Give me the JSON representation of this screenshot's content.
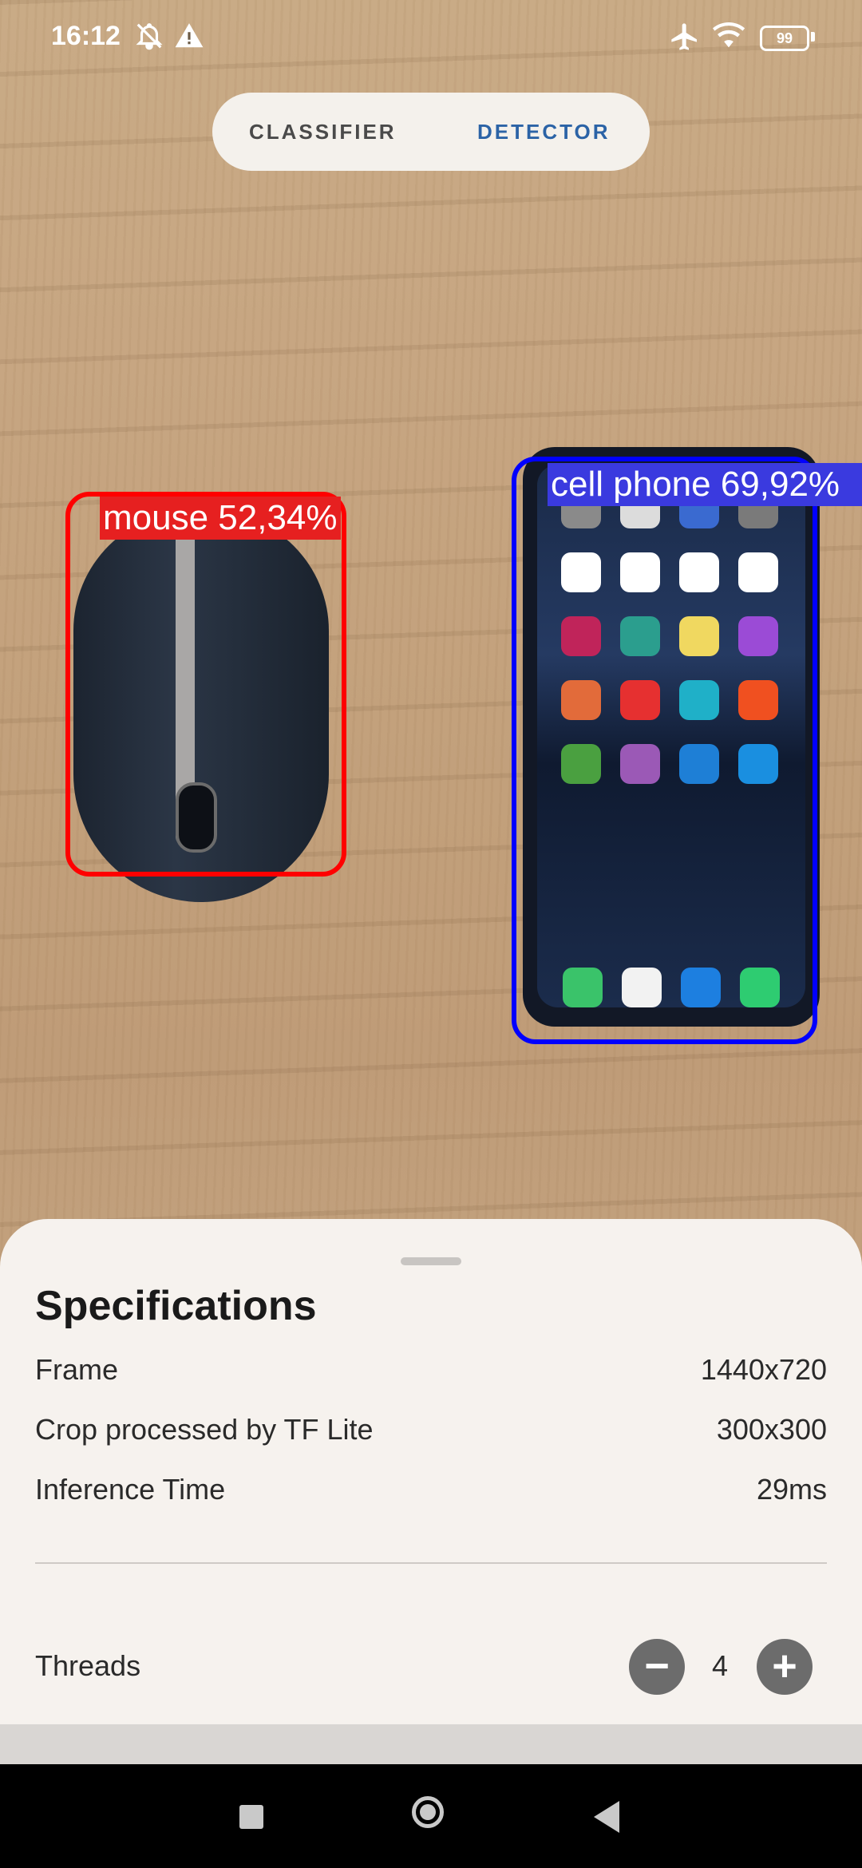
{
  "status_bar": {
    "time": "16:12",
    "battery": "99",
    "icons": [
      "mute-notifications-icon",
      "warning-icon",
      "airplane-icon",
      "wifi-icon",
      "battery-icon"
    ]
  },
  "tabs": [
    {
      "label": "CLASSIFIER",
      "active": false
    },
    {
      "label": "DETECTOR",
      "active": true
    }
  ],
  "detections": [
    {
      "label": "mouse 52,34%",
      "color": "#ff0000"
    },
    {
      "label": "cell phone 69,92%",
      "color": "#0000ff"
    }
  ],
  "sheet": {
    "title": "Specifications",
    "rows": [
      {
        "label": "Frame",
        "value": "1440x720"
      },
      {
        "label": "Crop processed by TF Lite",
        "value": "300x300"
      },
      {
        "label": "Inference Time",
        "value": "29ms"
      }
    ],
    "threads": {
      "label": "Threads",
      "value": "4",
      "minus": "−",
      "plus": "+"
    }
  },
  "nav": {
    "icons": [
      "recents-icon",
      "home-icon",
      "back-icon"
    ]
  }
}
